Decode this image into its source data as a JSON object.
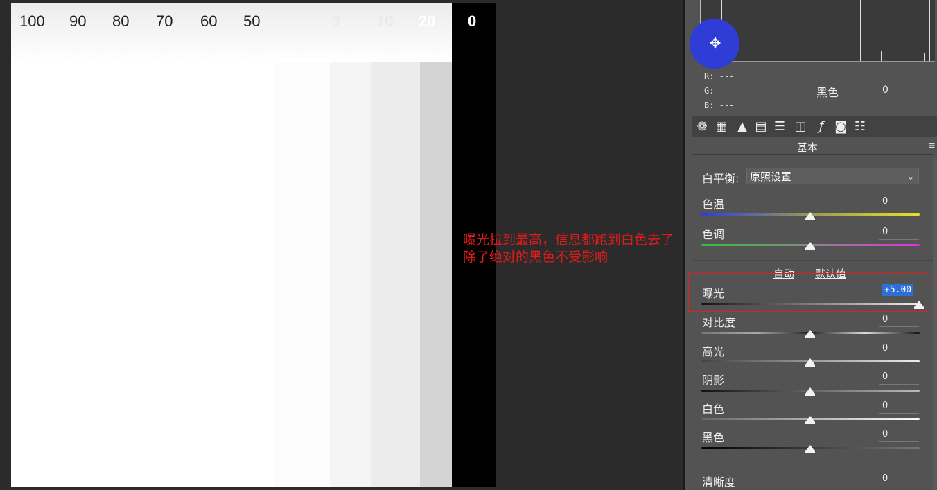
{
  "canvas": {
    "labels": [
      "100",
      "90",
      "80",
      "70",
      "60",
      "50",
      "3",
      "10",
      "20",
      "0"
    ]
  },
  "annotation": {
    "line1": "曝光拉到最高，信息都跑到白色去了",
    "line2": "除了绝对的黑色不受影响"
  },
  "info": {
    "r": "R:  ---",
    "g": "G:  ---",
    "b": "B:  ---",
    "label": "黑色",
    "value": "0"
  },
  "panel": {
    "tabs": [
      "aperture-icon",
      "grid-icon",
      "mountain-icon",
      "split-icon",
      "lines-icon",
      "lens-icon",
      "fx-icon",
      "camera-icon",
      "sliders-icon"
    ],
    "section_title": "基本",
    "white_balance_label": "白平衡:",
    "white_balance_value": "原照设置",
    "auto": "自动",
    "default": "默认值",
    "rows": [
      {
        "label": "色温",
        "value": "0"
      },
      {
        "label": "色调",
        "value": "0"
      },
      {
        "label": "曝光",
        "value": "+5.00"
      },
      {
        "label": "对比度",
        "value": "0"
      },
      {
        "label": "高光",
        "value": "0"
      },
      {
        "label": "阴影",
        "value": "0"
      },
      {
        "label": "白色",
        "value": "0"
      },
      {
        "label": "黑色",
        "value": "0"
      },
      {
        "label": "清晰度",
        "value": "0"
      }
    ]
  },
  "colors": {
    "annotation": "#e21b1b",
    "highlight": "#2d6fd6",
    "panel_bg": "#535353"
  }
}
